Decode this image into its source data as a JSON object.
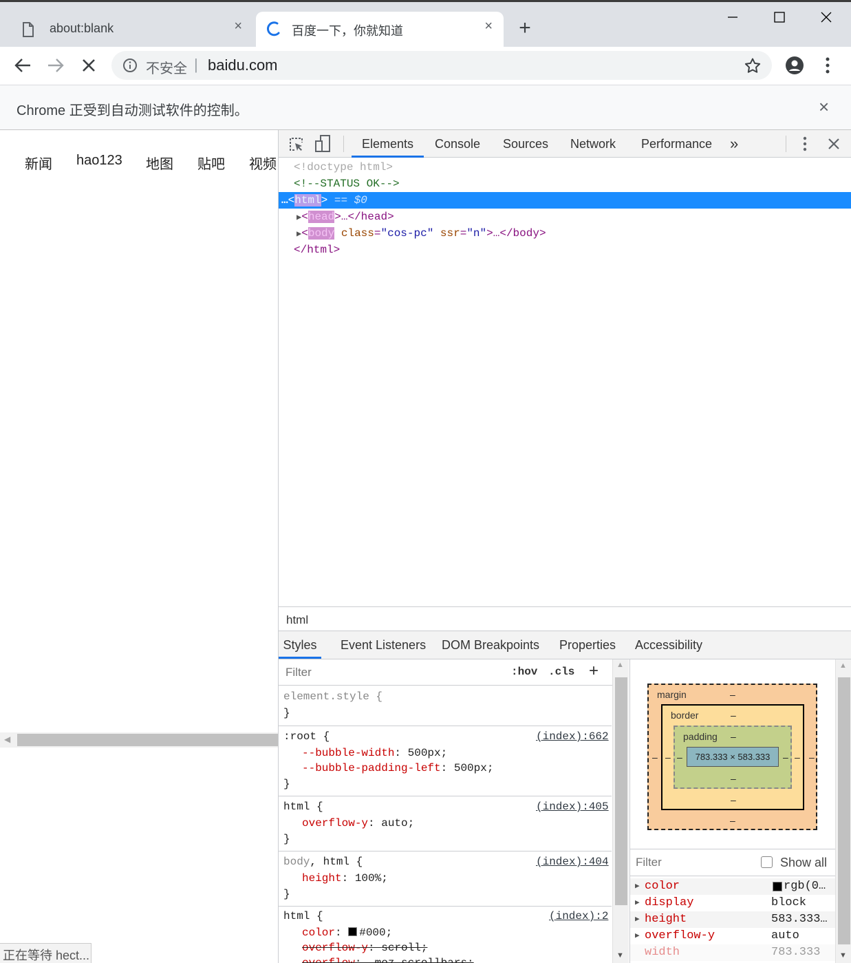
{
  "browser": {
    "tabs": [
      {
        "title": "about:blank",
        "close": "×"
      },
      {
        "title": "百度一下，你就知道",
        "close": "×"
      }
    ],
    "new_tab": "+",
    "window_controls": {
      "minimize": "–",
      "maximize": "☐",
      "close": "✕"
    }
  },
  "toolbar": {
    "security_label": "不安全",
    "separator": "|",
    "url": "baidu.com"
  },
  "infobar": {
    "text": "Chrome 正受到自动测试软件的控制。",
    "close": "×"
  },
  "page": {
    "nav": [
      "新闻",
      "hao123",
      "地图",
      "贴吧",
      "视频"
    ],
    "status": "正在等待 hect..."
  },
  "devtools": {
    "tabs": [
      "Elements",
      "Console",
      "Sources",
      "Network",
      "Performance"
    ],
    "more": "»",
    "elements": {
      "doctype": "<!doctype html>",
      "comment": "<!--STATUS OK-->",
      "html_open_dots": "…",
      "html_tag": "html",
      "selected_suffix": " == $0",
      "head_tag": "head",
      "head_rest": "…</head>",
      "body_tag": "body",
      "body_attr_class": "class",
      "body_class_val": "\"cos-pc\"",
      "body_attr_ssr": "ssr",
      "body_ssr_val": "\"n\"",
      "body_rest": "…</body>",
      "html_close": "</html>"
    },
    "breadcrumb": "html",
    "subtabs": [
      "Styles",
      "Event Listeners",
      "DOM Breakpoints",
      "Properties",
      "Accessibility"
    ],
    "styles": {
      "filter_placeholder": "Filter",
      "hov": ":hov",
      "cls": ".cls",
      "add": "+",
      "rules": [
        {
          "selector": "element.style {",
          "source": "",
          "props": [],
          "close": "}"
        },
        {
          "selector": ":root {",
          "source": "(index):662",
          "props": [
            {
              "name": "--bubble-width",
              "value": "500px;"
            },
            {
              "name": "--bubble-padding-left",
              "value": "500px;"
            }
          ],
          "close": "}"
        },
        {
          "selector": "html {",
          "source": "(index):405",
          "props": [
            {
              "name": "overflow-y",
              "value": "auto;"
            }
          ],
          "close": "}"
        },
        {
          "selector_a": "body",
          "selector_b": ", html {",
          "source": "(index):404",
          "props": [
            {
              "name": "height",
              "value": "100%;"
            }
          ],
          "close": "}"
        },
        {
          "selector": "html {",
          "source": "(index):2",
          "props": [
            {
              "name": "color",
              "value": "#000;"
            },
            {
              "name": "overflow-y",
              "value": "scroll;"
            },
            {
              "name": "overflow",
              "value": "-moz-scrollbars;"
            }
          ]
        }
      ]
    },
    "boxmodel": {
      "margin": "margin",
      "border": "border",
      "padding": "padding",
      "dash": "–",
      "content": "783.333 × 583.333"
    },
    "computed": {
      "filter_placeholder": "Filter",
      "show_all": "Show all",
      "rows": [
        {
          "name": "color",
          "value": "rgb(0…"
        },
        {
          "name": "display",
          "value": "block"
        },
        {
          "name": "height",
          "value": "583.333…"
        },
        {
          "name": "overflow-y",
          "value": "auto"
        },
        {
          "name": "width",
          "value": "783.333"
        }
      ]
    }
  },
  "colors": {
    "accent": "#1a73e8",
    "selection": "#1a8cff",
    "css_prop": "#c80000",
    "margin_box": "#f9cc9d",
    "border_box": "#fddd9b",
    "padding_box": "#c3d08b",
    "content_box": "#8cb6c0"
  }
}
